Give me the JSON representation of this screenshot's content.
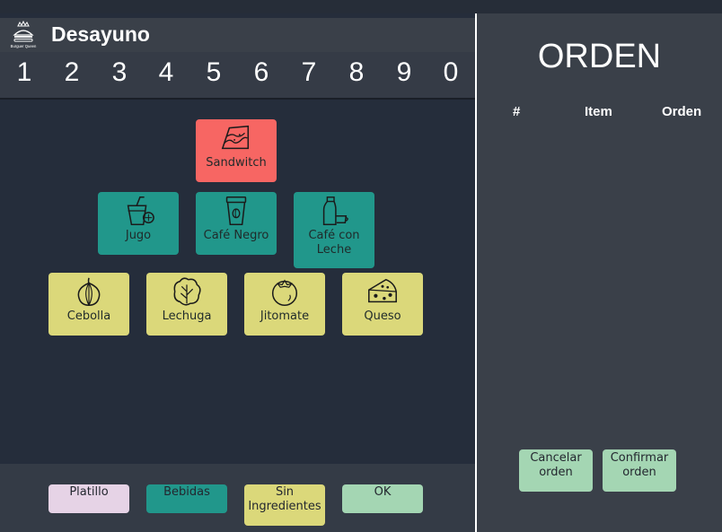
{
  "app": {
    "title": "Desayuno",
    "logo_text": "Burguer Queen"
  },
  "numpad": [
    "1",
    "2",
    "3",
    "4",
    "5",
    "6",
    "7",
    "8",
    "9",
    "0"
  ],
  "menu": {
    "sandwich": "Sandwitch",
    "jugo": "Jugo",
    "cafe_negro": "Café Negro",
    "cafe_leche_1": "Café con",
    "cafe_leche_2": "Leche",
    "cebolla": "Cebolla",
    "lechuga": "Lechuga",
    "jitomate": "Jitomate",
    "queso": "Queso"
  },
  "bottom": {
    "platillo": "Platillo",
    "bebidas": "Bebidas",
    "sin_1": "Sin",
    "sin_2": "Ingredientes",
    "ok": "OK"
  },
  "order": {
    "title": "ORDEN",
    "col_num": "#",
    "col_item": "Item",
    "col_orden": "Orden",
    "cancel_1": "Cancelar",
    "cancel_2": "orden",
    "confirm_1": "Confirmar",
    "confirm_2": "orden"
  },
  "colors": {
    "sandwich": "#f76663",
    "drinks": "#21978b",
    "ingredients": "#dbd87a",
    "platillo": "#e6d3e6",
    "ok": "#a4d6b3"
  }
}
